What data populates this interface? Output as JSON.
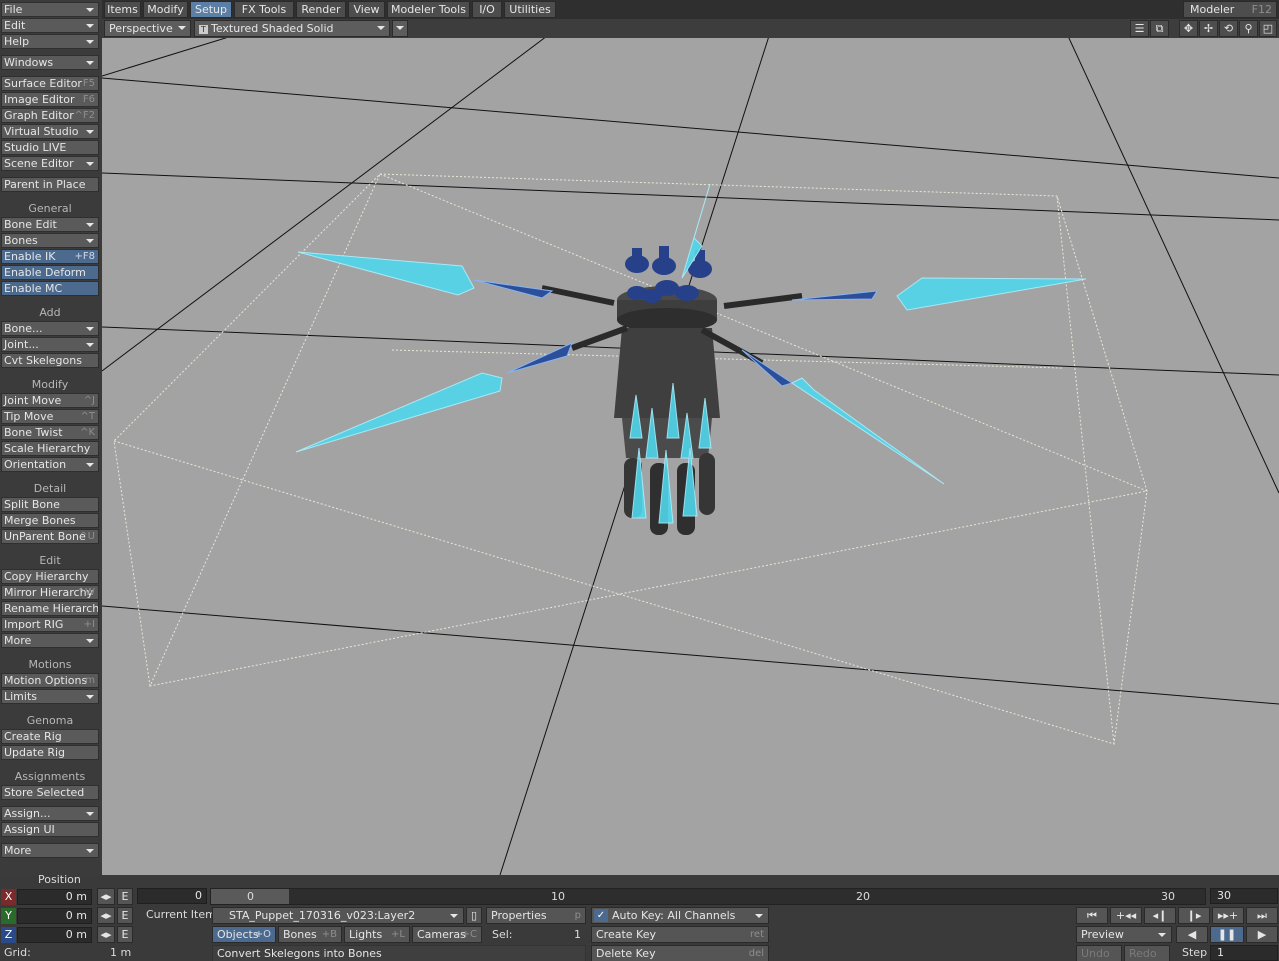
{
  "sidebar": {
    "file": "File",
    "edit": "Edit",
    "help": "Help",
    "windows": "Windows",
    "editors": [
      {
        "label": "Surface Editor",
        "shortcut": "F5"
      },
      {
        "label": "Image Editor",
        "shortcut": "F6"
      },
      {
        "label": "Graph Editor",
        "shortcut": "^F2"
      },
      {
        "label": "Virtual Studio",
        "shortcut": ""
      },
      {
        "label": "Studio LIVE",
        "shortcut": ""
      },
      {
        "label": "Scene Editor",
        "shortcut": ""
      }
    ],
    "parent_in_place": "Parent in Place",
    "general": {
      "header": "General",
      "bone_edit": "Bone Edit",
      "bones": "Bones",
      "enable_ik": "Enable IK",
      "enable_ik_sc": "+F8",
      "enable_deform": "Enable Deform",
      "enable_mc": "Enable MC"
    },
    "add": {
      "header": "Add",
      "bone": "Bone...",
      "joint": "Joint...",
      "cvt": "Cvt Skelegons"
    },
    "modify": {
      "header": "Modify",
      "joint_move": "Joint Move",
      "joint_move_sc": "^J",
      "tip_move": "Tip Move",
      "tip_move_sc": "^T",
      "bone_twist": "Bone Twist",
      "bone_twist_sc": "^K",
      "scale_hierarchy": "Scale Hierarchy",
      "orientation": "Orientation"
    },
    "detail": {
      "header": "Detail",
      "split_bone": "Split Bone",
      "merge_bones": "Merge Bones",
      "unparent_bone": "UnParent Bone",
      "unparent_sc": "^U"
    },
    "edit_sec": {
      "header": "Edit",
      "copy_h": "Copy Hierarchy",
      "mirror_h": "Mirror Hierarchy",
      "mirror_sc": "^W",
      "rename_h": "Rename Hierarchy",
      "import_rig": "Import RIG",
      "import_sc": "+I",
      "more": "More"
    },
    "motions": {
      "header": "Motions",
      "motion_options": "Motion Options",
      "motion_sc": "m",
      "limits": "Limits"
    },
    "genoma": {
      "header": "Genoma",
      "create_rig": "Create Rig",
      "update_rig": "Update Rig"
    },
    "assignments": {
      "header": "Assignments",
      "store_selected": "Store Selected",
      "assign": "Assign...",
      "assign_ui": "Assign UI"
    },
    "more2": "More",
    "position_header": "Position"
  },
  "tabs": [
    "Items",
    "Modify",
    "Setup",
    "FX Tools",
    "Render",
    "View",
    "Modeler Tools",
    "I/O",
    "Utilities"
  ],
  "modeler": {
    "label": "Modeler",
    "shortcut": "F12"
  },
  "view": {
    "perspective": "Perspective",
    "render_mode": "Textured Shaded Solid",
    "render_mode_icon": "T"
  },
  "timeline": {
    "current": "0",
    "ticks": [
      "0",
      "10",
      "20",
      "30"
    ],
    "end": "30",
    "start": "0"
  },
  "position": {
    "x": "0 m",
    "y": "0 m",
    "z": "0 m",
    "x_label": "X",
    "y_label": "Y",
    "z_label": "Z",
    "e": "E"
  },
  "grid": {
    "label": "Grid:",
    "value": "1 m"
  },
  "current_item": {
    "label": "Current Item",
    "value": "STA_Puppet_170316_v023:Layer2"
  },
  "properties": {
    "label": "Properties",
    "shortcut": "p"
  },
  "autokey": {
    "label": "Auto Key: All Channels"
  },
  "item_types": [
    {
      "label": "Objects",
      "shortcut": "+O"
    },
    {
      "label": "Bones",
      "shortcut": "+B"
    },
    {
      "label": "Lights",
      "shortcut": "+L"
    },
    {
      "label": "Cameras",
      "shortcut": "+C"
    }
  ],
  "sel": {
    "label": "Sel:",
    "value": "1"
  },
  "create_key": {
    "label": "Create Key",
    "shortcut": "ret"
  },
  "delete_key": {
    "label": "Delete Key",
    "shortcut": "del"
  },
  "status": "Convert Skelegons into Bones",
  "playback": {
    "preview": "Preview",
    "undo": "Undo",
    "redo": "Redo",
    "step_label": "Step",
    "step_value": "1"
  },
  "colors": {
    "accent": "#5c7fa6",
    "viewport": "#a3a3a3",
    "bone": "#4fd6ea",
    "bone_dark": "#2d4f9a"
  }
}
